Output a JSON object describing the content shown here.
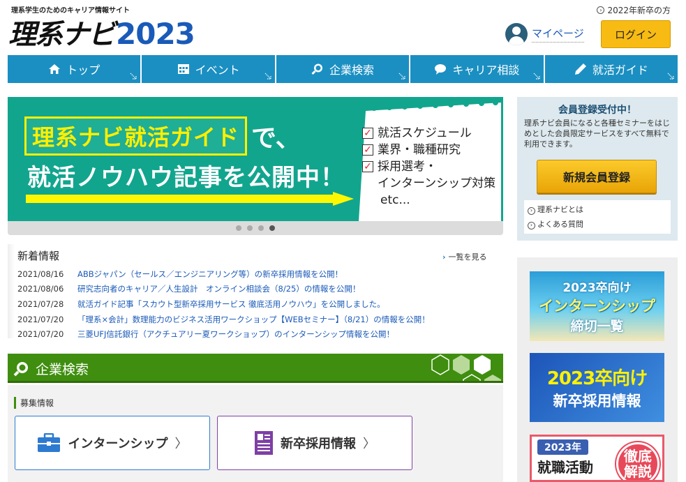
{
  "header": {
    "tagline": "理系学生のためのキャリア情報サイト",
    "logo_text": "理系ナビ",
    "logo_year": "2023",
    "prev_year_link": "2022年新卒の方",
    "mypage_label": "マイページ",
    "login_label": "ログイン"
  },
  "nav": {
    "items": [
      {
        "label": "トップ",
        "icon": "home-icon"
      },
      {
        "label": "イベント",
        "icon": "calendar-icon"
      },
      {
        "label": "企業検索",
        "icon": "magnifier-icon"
      },
      {
        "label": "キャリア相談",
        "icon": "speech-bubble-icon"
      },
      {
        "label": "就活ガイド",
        "icon": "pencil-icon"
      }
    ],
    "color": "#1b8fc2"
  },
  "banner": {
    "highlight": "理系ナビ就活ガイド",
    "highlight_suffix": "で、",
    "line2": "就活ノウハウ記事を公開中！",
    "checklist": [
      "就活スケジュール",
      "業界・職種研究",
      "採用選考・",
      "インターンシップ対策"
    ],
    "etc": "etc...",
    "slide_count": 4,
    "active_slide": 4
  },
  "news": {
    "title": "新着情報",
    "view_all": "一覧を見る",
    "items": [
      {
        "date": "2021/08/16",
        "text": "ABBジャパン（セールス／エンジニアリング等）の新卒採用情報を公開！"
      },
      {
        "date": "2021/08/06",
        "text": "研究志向者のキャリア／人生設計　オンライン相談会（8/25）の情報を公開！"
      },
      {
        "date": "2021/07/28",
        "text": "就活ガイド記事「スカウト型新卒採用サービス 徹底活用ノウハウ」を公開しました。"
      },
      {
        "date": "2021/07/20",
        "text": "「理系×会計」数理能力のビジネス活用ワークショップ【WEBセミナー】（8/21）の情報を公開！"
      },
      {
        "date": "2021/07/20",
        "text": "三菱UFJ信託銀行（アクチュアリー夏ワークショップ）のインターンシップ情報を公開！"
      }
    ]
  },
  "company_search": {
    "title": "企業検索",
    "sub_heading": "募集情報",
    "internship_label": "インターンシップ",
    "newgrad_label": "新卒採用情報",
    "header_color": "#3f8e0f"
  },
  "sidebar": {
    "reg_title": "会員登録受付中！",
    "reg_text": "理系ナビ会員になると各種セミナーをはじめとした会員限定サービスをすべて無料で利用できます。",
    "reg_button": "新規会員登録",
    "links": [
      "理系ナビとは",
      "よくある質問"
    ],
    "ads": [
      {
        "line1": "2023卒向け",
        "line2": "インターンシップ",
        "line3": "締切一覧"
      },
      {
        "line1": "2023卒向け",
        "line2": "新卒採用情報"
      },
      {
        "pill": "2023年",
        "line2": "就職活動",
        "seal1": "徹底",
        "seal2": "解説"
      }
    ]
  }
}
